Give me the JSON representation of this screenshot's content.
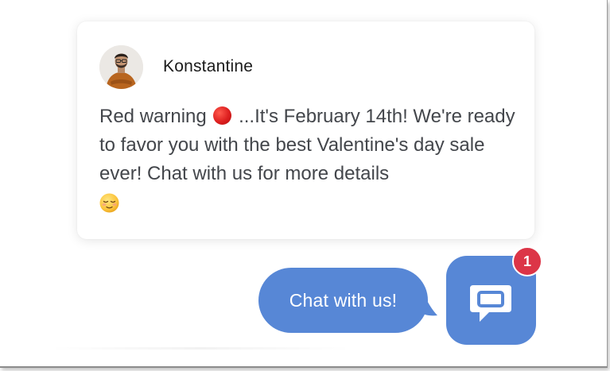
{
  "message_card": {
    "sender_name": "Konstantine",
    "avatar_icon": "person-avatar",
    "text_part1": "Red warning",
    "red_circle_icon": "red-circle-emoji",
    "text_part2": " ...It's February 14th! We're ready to favor you with the best Valentine's day sale ever! Chat with us for more details",
    "relieved_icon": "relieved-face-emoji"
  },
  "chat_bubble": {
    "label": "Chat with us!"
  },
  "launcher": {
    "icon": "chat-icon",
    "badge_count": "1"
  },
  "colors": {
    "accent": "#5787d6",
    "badge": "#dc3547",
    "text": "#43464b",
    "name": "#1b1b1b"
  }
}
